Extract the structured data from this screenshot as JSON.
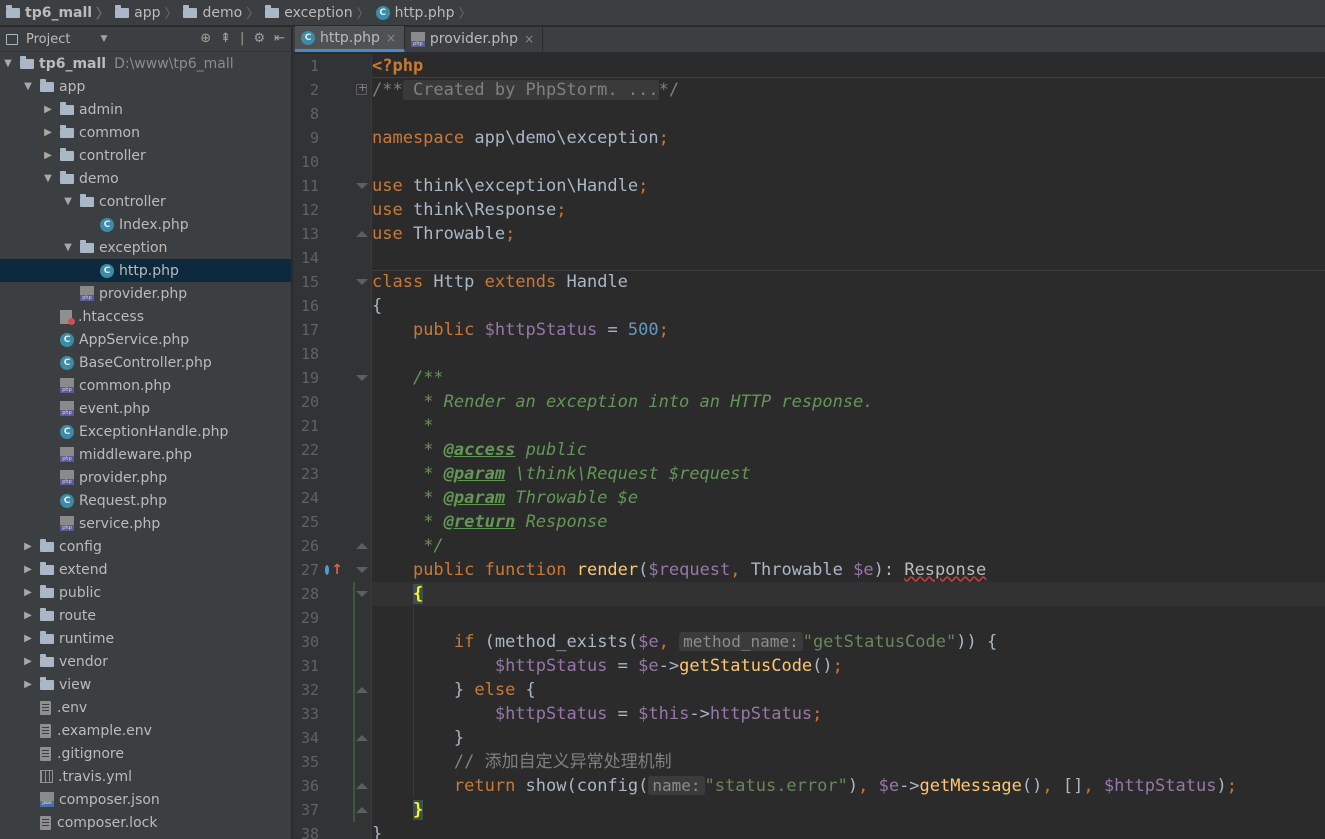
{
  "breadcrumb": [
    {
      "label": "tp6_mall",
      "icon": "project-folder-icon"
    },
    {
      "label": "app",
      "icon": "folder-icon"
    },
    {
      "label": "demo",
      "icon": "folder-icon"
    },
    {
      "label": "exception",
      "icon": "folder-icon"
    },
    {
      "label": "http.php",
      "icon": "php-class-icon"
    }
  ],
  "project_panel": {
    "title": "Project",
    "tree": [
      {
        "label": "tp6_mall",
        "extra": "D:\\www\\tp6_mall",
        "icon": "folder",
        "depth": 0,
        "arrow": "down",
        "bold": true
      },
      {
        "label": "app",
        "icon": "folder",
        "depth": 1,
        "arrow": "down"
      },
      {
        "label": "admin",
        "icon": "folder",
        "depth": 2,
        "arrow": "right"
      },
      {
        "label": "common",
        "icon": "folder",
        "depth": 2,
        "arrow": "right"
      },
      {
        "label": "controller",
        "icon": "folder",
        "depth": 2,
        "arrow": "right"
      },
      {
        "label": "demo",
        "icon": "folder",
        "depth": 2,
        "arrow": "down"
      },
      {
        "label": "controller",
        "icon": "folder",
        "depth": 3,
        "arrow": "down"
      },
      {
        "label": "Index.php",
        "icon": "class",
        "depth": 4
      },
      {
        "label": "exception",
        "icon": "folder",
        "depth": 3,
        "arrow": "down"
      },
      {
        "label": "http.php",
        "icon": "class",
        "depth": 4,
        "selected": true
      },
      {
        "label": "provider.php",
        "icon": "php",
        "depth": 3
      },
      {
        "label": ".htaccess",
        "icon": "htaccess",
        "depth": 2
      },
      {
        "label": "AppService.php",
        "icon": "class",
        "depth": 2
      },
      {
        "label": "BaseController.php",
        "icon": "class",
        "depth": 2
      },
      {
        "label": "common.php",
        "icon": "php",
        "depth": 2
      },
      {
        "label": "event.php",
        "icon": "php",
        "depth": 2
      },
      {
        "label": "ExceptionHandle.php",
        "icon": "class",
        "depth": 2
      },
      {
        "label": "middleware.php",
        "icon": "php",
        "depth": 2
      },
      {
        "label": "provider.php",
        "icon": "php",
        "depth": 2
      },
      {
        "label": "Request.php",
        "icon": "class",
        "depth": 2
      },
      {
        "label": "service.php",
        "icon": "php",
        "depth": 2
      },
      {
        "label": "config",
        "icon": "folder",
        "depth": 1,
        "arrow": "right"
      },
      {
        "label": "extend",
        "icon": "folder",
        "depth": 1,
        "arrow": "right"
      },
      {
        "label": "public",
        "icon": "folder",
        "depth": 1,
        "arrow": "right"
      },
      {
        "label": "route",
        "icon": "folder",
        "depth": 1,
        "arrow": "right"
      },
      {
        "label": "runtime",
        "icon": "folder",
        "depth": 1,
        "arrow": "right"
      },
      {
        "label": "vendor",
        "icon": "folder",
        "depth": 1,
        "arrow": "right"
      },
      {
        "label": "view",
        "icon": "folder",
        "depth": 1,
        "arrow": "right"
      },
      {
        "label": ".env",
        "icon": "file",
        "depth": 1
      },
      {
        "label": ".example.env",
        "icon": "file",
        "depth": 1
      },
      {
        "label": ".gitignore",
        "icon": "file",
        "depth": 1
      },
      {
        "label": ".travis.yml",
        "icon": "yml",
        "depth": 1
      },
      {
        "label": "composer.json",
        "icon": "json",
        "depth": 1
      },
      {
        "label": "composer.lock",
        "icon": "file",
        "depth": 1
      }
    ]
  },
  "editor_tabs": [
    {
      "label": "http.php",
      "icon": "class",
      "active": true,
      "close": "×"
    },
    {
      "label": "provider.php",
      "icon": "php",
      "active": false,
      "close": "×"
    }
  ],
  "code_lines": [
    {
      "num": "1",
      "tokens": [
        [
          "ph",
          "<?php"
        ]
      ]
    },
    {
      "num": "2",
      "tokens": [
        [
          "cm",
          "/**"
        ],
        [
          "fc",
          " Created by PhpStorm. ..."
        ],
        [
          "cm",
          "*/"
        ]
      ]
    },
    {
      "num": "8",
      "tokens": []
    },
    {
      "num": "9",
      "tokens": [
        [
          "k",
          "namespace "
        ],
        [
          "plain",
          "app\\demo\\exception"
        ],
        [
          "k",
          ";"
        ]
      ]
    },
    {
      "num": "10",
      "tokens": []
    },
    {
      "num": "11",
      "tokens": [
        [
          "k",
          "use "
        ],
        [
          "plain",
          "think\\exception\\Handle"
        ],
        [
          "k",
          ";"
        ]
      ]
    },
    {
      "num": "12",
      "tokens": [
        [
          "k",
          "use "
        ],
        [
          "plain",
          "think\\Response"
        ],
        [
          "k",
          ";"
        ]
      ]
    },
    {
      "num": "13",
      "tokens": [
        [
          "k",
          "use "
        ],
        [
          "plain",
          "Throwable"
        ],
        [
          "k",
          ";"
        ]
      ]
    },
    {
      "num": "14",
      "tokens": []
    },
    {
      "num": "15",
      "tokens": [
        [
          "k",
          "class "
        ],
        [
          "plain",
          "Http "
        ],
        [
          "k",
          "extends "
        ],
        [
          "plain",
          "Handle"
        ]
      ]
    },
    {
      "num": "16",
      "tokens": [
        [
          "plain",
          "{"
        ]
      ]
    },
    {
      "num": "17",
      "tokens": [
        [
          "plain",
          "    "
        ],
        [
          "k",
          "public "
        ],
        [
          "var",
          "$httpStatus "
        ],
        [
          "plain",
          "= "
        ],
        [
          "num",
          "500"
        ],
        [
          "k",
          ";"
        ]
      ]
    },
    {
      "num": "18",
      "tokens": []
    },
    {
      "num": "19",
      "tokens": [
        [
          "plain",
          "    "
        ],
        [
          "doc",
          "/**"
        ]
      ]
    },
    {
      "num": "20",
      "tokens": [
        [
          "plain",
          "     "
        ],
        [
          "doc",
          "* Render an exception into an HTTP response."
        ]
      ]
    },
    {
      "num": "21",
      "tokens": [
        [
          "plain",
          "     "
        ],
        [
          "doc",
          "*"
        ]
      ]
    },
    {
      "num": "22",
      "tokens": [
        [
          "plain",
          "     "
        ],
        [
          "doc",
          "* "
        ],
        [
          "doct",
          "@access"
        ],
        [
          "doc",
          " public"
        ]
      ]
    },
    {
      "num": "23",
      "tokens": [
        [
          "plain",
          "     "
        ],
        [
          "doc",
          "* "
        ],
        [
          "doct",
          "@param"
        ],
        [
          "doc",
          " \\think\\Request $request"
        ]
      ]
    },
    {
      "num": "24",
      "tokens": [
        [
          "plain",
          "     "
        ],
        [
          "doc",
          "* "
        ],
        [
          "doct",
          "@param"
        ],
        [
          "doc",
          " Throwable $e"
        ]
      ]
    },
    {
      "num": "25",
      "tokens": [
        [
          "plain",
          "     "
        ],
        [
          "doc",
          "* "
        ],
        [
          "doct",
          "@return"
        ],
        [
          "doc",
          " Response"
        ]
      ]
    },
    {
      "num": "26",
      "tokens": [
        [
          "plain",
          "     "
        ],
        [
          "doc",
          "*/"
        ]
      ]
    },
    {
      "num": "27",
      "tokens": [
        [
          "plain",
          "    "
        ],
        [
          "k",
          "public function "
        ],
        [
          "fn",
          "render"
        ],
        [
          "plain",
          "("
        ],
        [
          "var",
          "$request"
        ],
        [
          "k",
          ", "
        ],
        [
          "plain",
          "Throwable "
        ],
        [
          "var",
          "$e"
        ],
        [
          "plain",
          "): "
        ],
        [
          "wave",
          "Response"
        ]
      ]
    },
    {
      "num": "28",
      "tokens": [
        [
          "plain",
          "    "
        ],
        [
          "brace-hl",
          "{"
        ]
      ]
    },
    {
      "num": "29",
      "tokens": []
    },
    {
      "num": "30",
      "tokens": [
        [
          "plain",
          "        "
        ],
        [
          "k",
          "if "
        ],
        [
          "plain",
          "(method_exists("
        ],
        [
          "var",
          "$e"
        ],
        [
          "k",
          ", "
        ],
        [
          "hint",
          "method_name:"
        ],
        [
          "str",
          "\"getStatusCode\""
        ],
        [
          "plain",
          ")) {"
        ]
      ]
    },
    {
      "num": "31",
      "tokens": [
        [
          "plain",
          "            "
        ],
        [
          "var",
          "$httpStatus "
        ],
        [
          "plain",
          "= "
        ],
        [
          "var",
          "$e"
        ],
        [
          "plain",
          "->"
        ],
        [
          "fn",
          "getStatusCode"
        ],
        [
          "plain",
          "()"
        ],
        [
          "k",
          ";"
        ]
      ]
    },
    {
      "num": "32",
      "tokens": [
        [
          "plain",
          "        } "
        ],
        [
          "k",
          "else "
        ],
        [
          "plain",
          "{"
        ]
      ]
    },
    {
      "num": "33",
      "tokens": [
        [
          "plain",
          "            "
        ],
        [
          "var",
          "$httpStatus "
        ],
        [
          "plain",
          "= "
        ],
        [
          "var",
          "$this"
        ],
        [
          "plain",
          "->"
        ],
        [
          "var",
          "httpStatus"
        ],
        [
          "k",
          ";"
        ]
      ]
    },
    {
      "num": "34",
      "tokens": [
        [
          "plain",
          "        }"
        ]
      ]
    },
    {
      "num": "35",
      "tokens": [
        [
          "plain",
          "        "
        ],
        [
          "cm",
          "// 添加自定义异常处理机制"
        ]
      ]
    },
    {
      "num": "36",
      "tokens": [
        [
          "plain",
          "        "
        ],
        [
          "k",
          "return "
        ],
        [
          "plain",
          "show(config("
        ],
        [
          "hint",
          "name:"
        ],
        [
          "str",
          "\"status.error\""
        ],
        [
          "plain",
          ")"
        ],
        [
          "k",
          ", "
        ],
        [
          "var",
          "$e"
        ],
        [
          "plain",
          "->"
        ],
        [
          "fn",
          "getMessage"
        ],
        [
          "plain",
          "()"
        ],
        [
          "k",
          ", "
        ],
        [
          "plain",
          "[]"
        ],
        [
          "k",
          ", "
        ],
        [
          "var",
          "$httpStatus"
        ],
        [
          "plain",
          ")"
        ],
        [
          "k",
          ";"
        ]
      ]
    },
    {
      "num": "37",
      "tokens": [
        [
          "plain",
          "    "
        ],
        [
          "brace-hl",
          "}"
        ]
      ]
    },
    {
      "num": "38",
      "tokens": [
        [
          "plain",
          "}"
        ]
      ]
    }
  ]
}
